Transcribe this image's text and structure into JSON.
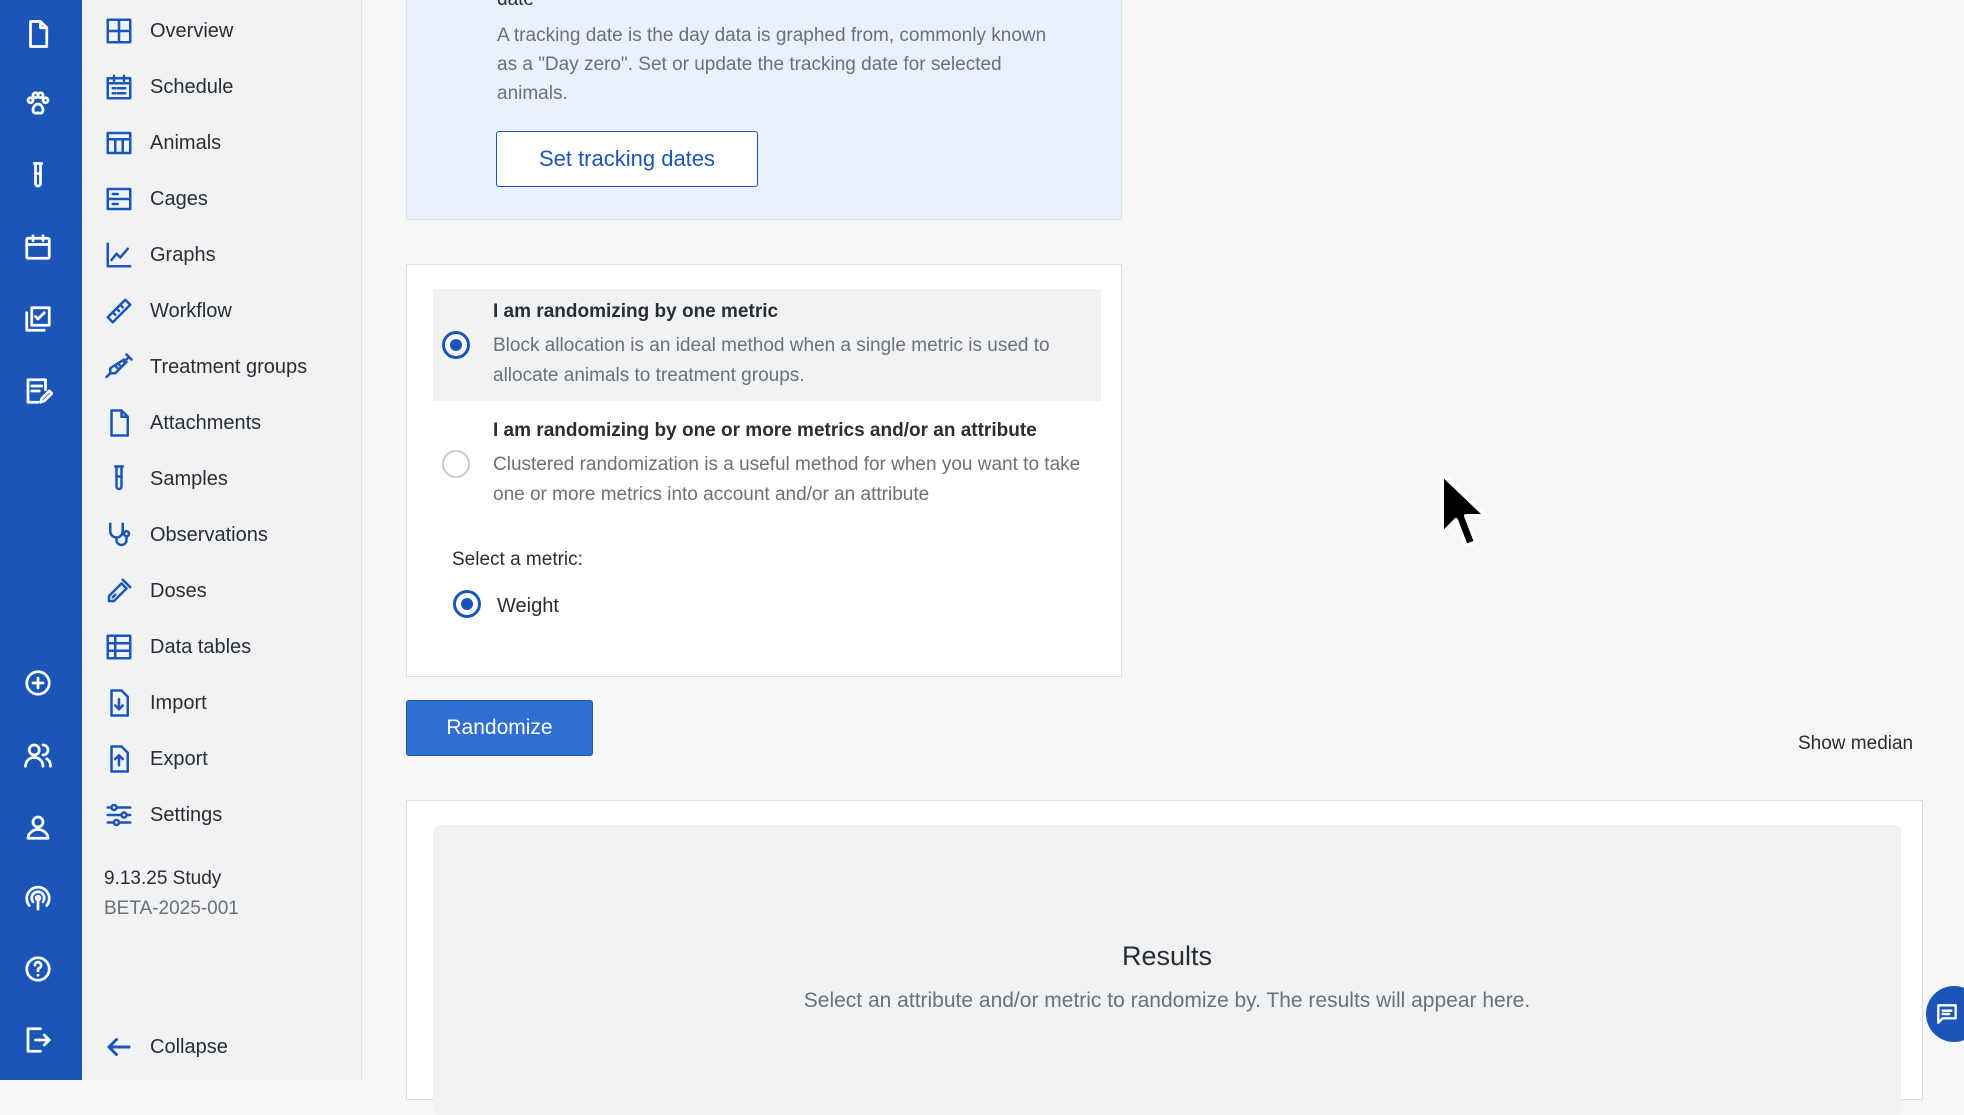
{
  "rail": {
    "icons": [
      "document-icon",
      "paw-icon",
      "test-tube-icon",
      "calendar-icon",
      "checklist-icon",
      "edit-note-icon",
      "add-circle-icon",
      "users-icon",
      "user-icon",
      "support-icon",
      "help-icon",
      "logout-icon"
    ]
  },
  "nav": {
    "items": [
      {
        "label": "Overview",
        "icon": "grid-icon"
      },
      {
        "label": "Schedule",
        "icon": "calendar-list-icon"
      },
      {
        "label": "Animals",
        "icon": "table-columns-icon"
      },
      {
        "label": "Cages",
        "icon": "cages-icon"
      },
      {
        "label": "Graphs",
        "icon": "line-chart-icon"
      },
      {
        "label": "Workflow",
        "icon": "ruler-icon"
      },
      {
        "label": "Treatment groups",
        "icon": "syringe-icon"
      },
      {
        "label": "Attachments",
        "icon": "document-icon"
      },
      {
        "label": "Samples",
        "icon": "test-tube-icon"
      },
      {
        "label": "Observations",
        "icon": "stethoscope-icon"
      },
      {
        "label": "Doses",
        "icon": "dropper-icon"
      },
      {
        "label": "Data tables",
        "icon": "table-icon"
      },
      {
        "label": "Import",
        "icon": "import-icon"
      },
      {
        "label": "Export",
        "icon": "export-icon"
      },
      {
        "label": "Settings",
        "icon": "sliders-icon"
      }
    ],
    "study_name": "9.13.25 Study",
    "study_id": "BETA-2025-001",
    "collapse_label": "Collapse"
  },
  "tracking": {
    "title_fragment": "date",
    "description": "A tracking date is the day data is graphed from, commonly known as a \"Day zero\". Set or update the tracking date for selected animals.",
    "button_label": "Set tracking dates"
  },
  "randomization": {
    "options": [
      {
        "title": "I am randomizing by one metric",
        "description": "Block allocation is an ideal method when a single metric is used to allocate animals to treatment groups.",
        "selected": true
      },
      {
        "title": "I am randomizing by one or more metrics and/or an attribute",
        "description": "Clustered randomization is a useful method for when you want to take one or more metrics into account and/or an attribute",
        "selected": false
      }
    ],
    "metric_label": "Select a metric:",
    "metric_value": "Weight",
    "randomize_label": "Randomize",
    "show_median_label": "Show median"
  },
  "results": {
    "title": "Results",
    "subtitle": "Select an attribute and/or metric to randomize by. The results will appear here."
  },
  "colors": {
    "brand": "#1b55b8",
    "primary_button": "#2f6fd2",
    "info_bg": "#e9f1fb"
  }
}
